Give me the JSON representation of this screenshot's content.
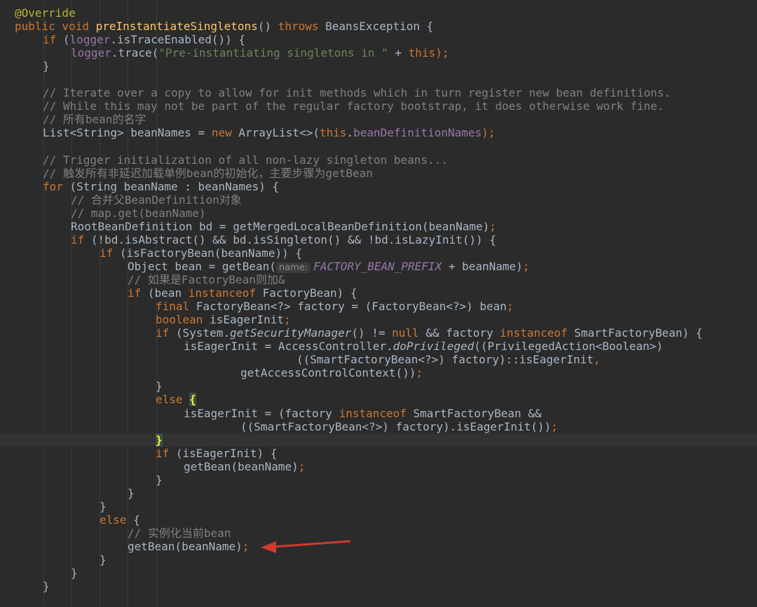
{
  "editor": {
    "theme": "darcula",
    "colors": {
      "background": "#2b2b2b",
      "keyword": "#cc7832",
      "method_declaration": "#ffc66d",
      "field": "#9876aa",
      "string": "#6a8759",
      "comment": "#808080",
      "annotation": "#bbb529",
      "annotation_arrow": "#d03a2e"
    },
    "lines": [
      {
        "indent": 0,
        "tokens": [
          {
            "t": "@Override",
            "c": "annotation"
          }
        ]
      },
      {
        "indent": 0,
        "tokens": [
          {
            "t": "public void ",
            "c": "keyword"
          },
          {
            "t": "preInstantiateSingletons",
            "c": "method-decl"
          },
          {
            "t": "() ",
            "c": "plain"
          },
          {
            "t": "throws ",
            "c": "keyword"
          },
          {
            "t": "BeansException {",
            "c": "plain"
          }
        ]
      },
      {
        "indent": 1,
        "tokens": [
          {
            "t": "if ",
            "c": "keyword"
          },
          {
            "t": "(",
            "c": "plain"
          },
          {
            "t": "logger",
            "c": "field"
          },
          {
            "t": ".isTraceEnabled()) {",
            "c": "plain"
          }
        ]
      },
      {
        "indent": 2,
        "tokens": [
          {
            "t": "logger",
            "c": "field"
          },
          {
            "t": ".trace(",
            "c": "plain"
          },
          {
            "t": "\"Pre-instantiating singletons in \"",
            "c": "string"
          },
          {
            "t": " + ",
            "c": "plain"
          },
          {
            "t": "this",
            "c": "keyword"
          },
          {
            "t": ");",
            "c": "keyword"
          }
        ]
      },
      {
        "indent": 1,
        "tokens": [
          {
            "t": "}",
            "c": "plain"
          }
        ]
      },
      {
        "indent": 0,
        "tokens": []
      },
      {
        "indent": 1,
        "tokens": [
          {
            "t": "// Iterate over a copy to allow for init methods which in turn register new bean definitions.",
            "c": "comment"
          }
        ]
      },
      {
        "indent": 1,
        "tokens": [
          {
            "t": "// While this may not be part of the regular factory bootstrap, it does otherwise work fine.",
            "c": "comment"
          }
        ]
      },
      {
        "indent": 1,
        "tokens": [
          {
            "t": "// 所有bean的名字",
            "c": "comment"
          }
        ]
      },
      {
        "indent": 1,
        "tokens": [
          {
            "t": "List<String> beanNames = ",
            "c": "plain"
          },
          {
            "t": "new ",
            "c": "keyword"
          },
          {
            "t": "ArrayList<>(",
            "c": "plain"
          },
          {
            "t": "this",
            "c": "keyword"
          },
          {
            "t": ".",
            "c": "plain"
          },
          {
            "t": "beanDefinitionNames",
            "c": "field"
          },
          {
            "t": ");",
            "c": "keyword"
          }
        ]
      },
      {
        "indent": 0,
        "tokens": []
      },
      {
        "indent": 1,
        "tokens": [
          {
            "t": "// Trigger initialization of all non-lazy singleton beans...",
            "c": "comment"
          }
        ]
      },
      {
        "indent": 1,
        "tokens": [
          {
            "t": "// 触发所有非延迟加载单例bean的初始化，主要步骤为getBean",
            "c": "comment"
          }
        ]
      },
      {
        "indent": 1,
        "tokens": [
          {
            "t": "for ",
            "c": "keyword"
          },
          {
            "t": "(String beanName : beanNames) {",
            "c": "plain"
          }
        ]
      },
      {
        "indent": 2,
        "tokens": [
          {
            "t": "// 合并父BeanDefinition对象",
            "c": "comment"
          }
        ]
      },
      {
        "indent": 2,
        "tokens": [
          {
            "t": "// map.get(beanName)",
            "c": "comment"
          }
        ]
      },
      {
        "indent": 2,
        "tokens": [
          {
            "t": "RootBeanDefinition bd = getMergedLocalBeanDefinition(beanName)",
            "c": "plain"
          },
          {
            "t": ";",
            "c": "keyword"
          }
        ]
      },
      {
        "indent": 2,
        "tokens": [
          {
            "t": "if ",
            "c": "keyword"
          },
          {
            "t": "(!bd.isAbstract() && bd.isSingleton() && !bd.isLazyInit()) {",
            "c": "plain"
          }
        ]
      },
      {
        "indent": 3,
        "tokens": [
          {
            "t": "if ",
            "c": "keyword"
          },
          {
            "t": "(isFactoryBean(beanName)) {",
            "c": "plain"
          }
        ]
      },
      {
        "indent": 4,
        "tokens": [
          {
            "t": "Object bean = getBean(",
            "c": "plain"
          },
          {
            "t": "name:",
            "c": "hint"
          },
          {
            "t": "FACTORY_BEAN_PREFIX",
            "c": "const"
          },
          {
            "t": " + beanName)",
            "c": "plain"
          },
          {
            "t": ";",
            "c": "keyword"
          }
        ]
      },
      {
        "indent": 4,
        "tokens": [
          {
            "t": "// 如果是FactoryBean则加&",
            "c": "comment"
          }
        ]
      },
      {
        "indent": 4,
        "tokens": [
          {
            "t": "if ",
            "c": "keyword"
          },
          {
            "t": "(bean ",
            "c": "plain"
          },
          {
            "t": "instanceof ",
            "c": "keyword"
          },
          {
            "t": "FactoryBean) {",
            "c": "plain"
          }
        ]
      },
      {
        "indent": 5,
        "tokens": [
          {
            "t": "final ",
            "c": "keyword"
          },
          {
            "t": "FactoryBean<?> factory = (FactoryBean<?>) bean",
            "c": "plain"
          },
          {
            "t": ";",
            "c": "keyword"
          }
        ]
      },
      {
        "indent": 5,
        "tokens": [
          {
            "t": "boolean ",
            "c": "keyword"
          },
          {
            "t": "isEagerInit",
            "c": "plain"
          },
          {
            "t": ";",
            "c": "keyword"
          }
        ]
      },
      {
        "indent": 5,
        "tokens": [
          {
            "t": "if ",
            "c": "keyword"
          },
          {
            "t": "(System.",
            "c": "plain"
          },
          {
            "t": "getSecurityManager",
            "c": "static"
          },
          {
            "t": "() != ",
            "c": "plain"
          },
          {
            "t": "null ",
            "c": "keyword"
          },
          {
            "t": "&& factory ",
            "c": "plain"
          },
          {
            "t": "instanceof ",
            "c": "keyword"
          },
          {
            "t": "SmartFactoryBean) {",
            "c": "plain"
          }
        ]
      },
      {
        "indent": 6,
        "tokens": [
          {
            "t": "isEagerInit = AccessController.",
            "c": "plain"
          },
          {
            "t": "doPrivileged",
            "c": "static"
          },
          {
            "t": "((PrivilegedAction<Boolean>)",
            "c": "plain"
          }
        ]
      },
      {
        "indent": 10,
        "tokens": [
          {
            "t": "((SmartFactoryBean<?>) factory)::isEagerInit",
            "c": "plain"
          },
          {
            "t": ",",
            "c": "keyword"
          }
        ]
      },
      {
        "indent": 8,
        "tokens": [
          {
            "t": "getAccessControlContext())",
            "c": "plain"
          },
          {
            "t": ";",
            "c": "keyword"
          }
        ]
      },
      {
        "indent": 5,
        "tokens": [
          {
            "t": "}",
            "c": "plain"
          }
        ]
      },
      {
        "indent": 5,
        "tokens": [
          {
            "t": "else ",
            "c": "keyword"
          },
          {
            "t": "{",
            "c": "match"
          }
        ]
      },
      {
        "indent": 6,
        "tokens": [
          {
            "t": "isEagerInit = (factory ",
            "c": "plain"
          },
          {
            "t": "instanceof ",
            "c": "keyword"
          },
          {
            "t": "SmartFactoryBean &&",
            "c": "plain"
          }
        ]
      },
      {
        "indent": 8,
        "tokens": [
          {
            "t": "((SmartFactoryBean<?>) factory).isEagerInit())",
            "c": "plain"
          },
          {
            "t": ";",
            "c": "keyword"
          }
        ]
      },
      {
        "indent": 5,
        "caret": true,
        "tokens": [
          {
            "t": "}",
            "c": "match"
          }
        ]
      },
      {
        "indent": 5,
        "tokens": [
          {
            "t": "if ",
            "c": "keyword"
          },
          {
            "t": "(isEagerInit) {",
            "c": "plain"
          }
        ]
      },
      {
        "indent": 6,
        "tokens": [
          {
            "t": "getBean(beanName)",
            "c": "plain"
          },
          {
            "t": ";",
            "c": "keyword"
          }
        ]
      },
      {
        "indent": 5,
        "tokens": [
          {
            "t": "}",
            "c": "plain"
          }
        ]
      },
      {
        "indent": 4,
        "tokens": [
          {
            "t": "}",
            "c": "plain"
          }
        ]
      },
      {
        "indent": 3,
        "tokens": [
          {
            "t": "}",
            "c": "plain"
          }
        ]
      },
      {
        "indent": 3,
        "tokens": [
          {
            "t": "else ",
            "c": "keyword"
          },
          {
            "t": "{",
            "c": "plain"
          }
        ]
      },
      {
        "indent": 4,
        "tokens": [
          {
            "t": "// 实例化当前bean",
            "c": "comment"
          }
        ]
      },
      {
        "indent": 4,
        "tokens": [
          {
            "t": "getBean(beanName)",
            "c": "plain"
          },
          {
            "t": ";",
            "c": "keyword"
          }
        ]
      },
      {
        "indent": 3,
        "tokens": [
          {
            "t": "}",
            "c": "plain"
          }
        ]
      },
      {
        "indent": 2,
        "tokens": [
          {
            "t": "}",
            "c": "plain"
          }
        ]
      },
      {
        "indent": 1,
        "tokens": [
          {
            "t": "}",
            "c": "plain"
          }
        ]
      }
    ]
  },
  "annotation_arrow": {
    "points_to_line": 40,
    "color": "#d03a2e"
  }
}
